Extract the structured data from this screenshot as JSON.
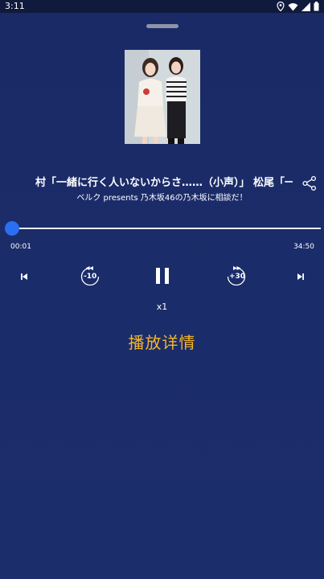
{
  "status_bar": {
    "time": "3:11",
    "icons": [
      "location-icon",
      "wifi-icon",
      "signal-icon",
      "battery-icon"
    ]
  },
  "player": {
    "track_title": "村「一緒に行く人いないからさ……（小声）」 松尾「一人で",
    "subtitle": "ベルク presents 乃木坂46の乃木坂に相談だ！",
    "current_time": "00:01",
    "total_time": "34:50",
    "progress": 0.0005,
    "rewind_label": "-10",
    "forward_label": "+30",
    "speed": "x1",
    "details_label": "播放详情"
  },
  "colors": {
    "background": "#1b2c6a",
    "accent": "#2b6ef2",
    "details_text": "#f5b529"
  }
}
